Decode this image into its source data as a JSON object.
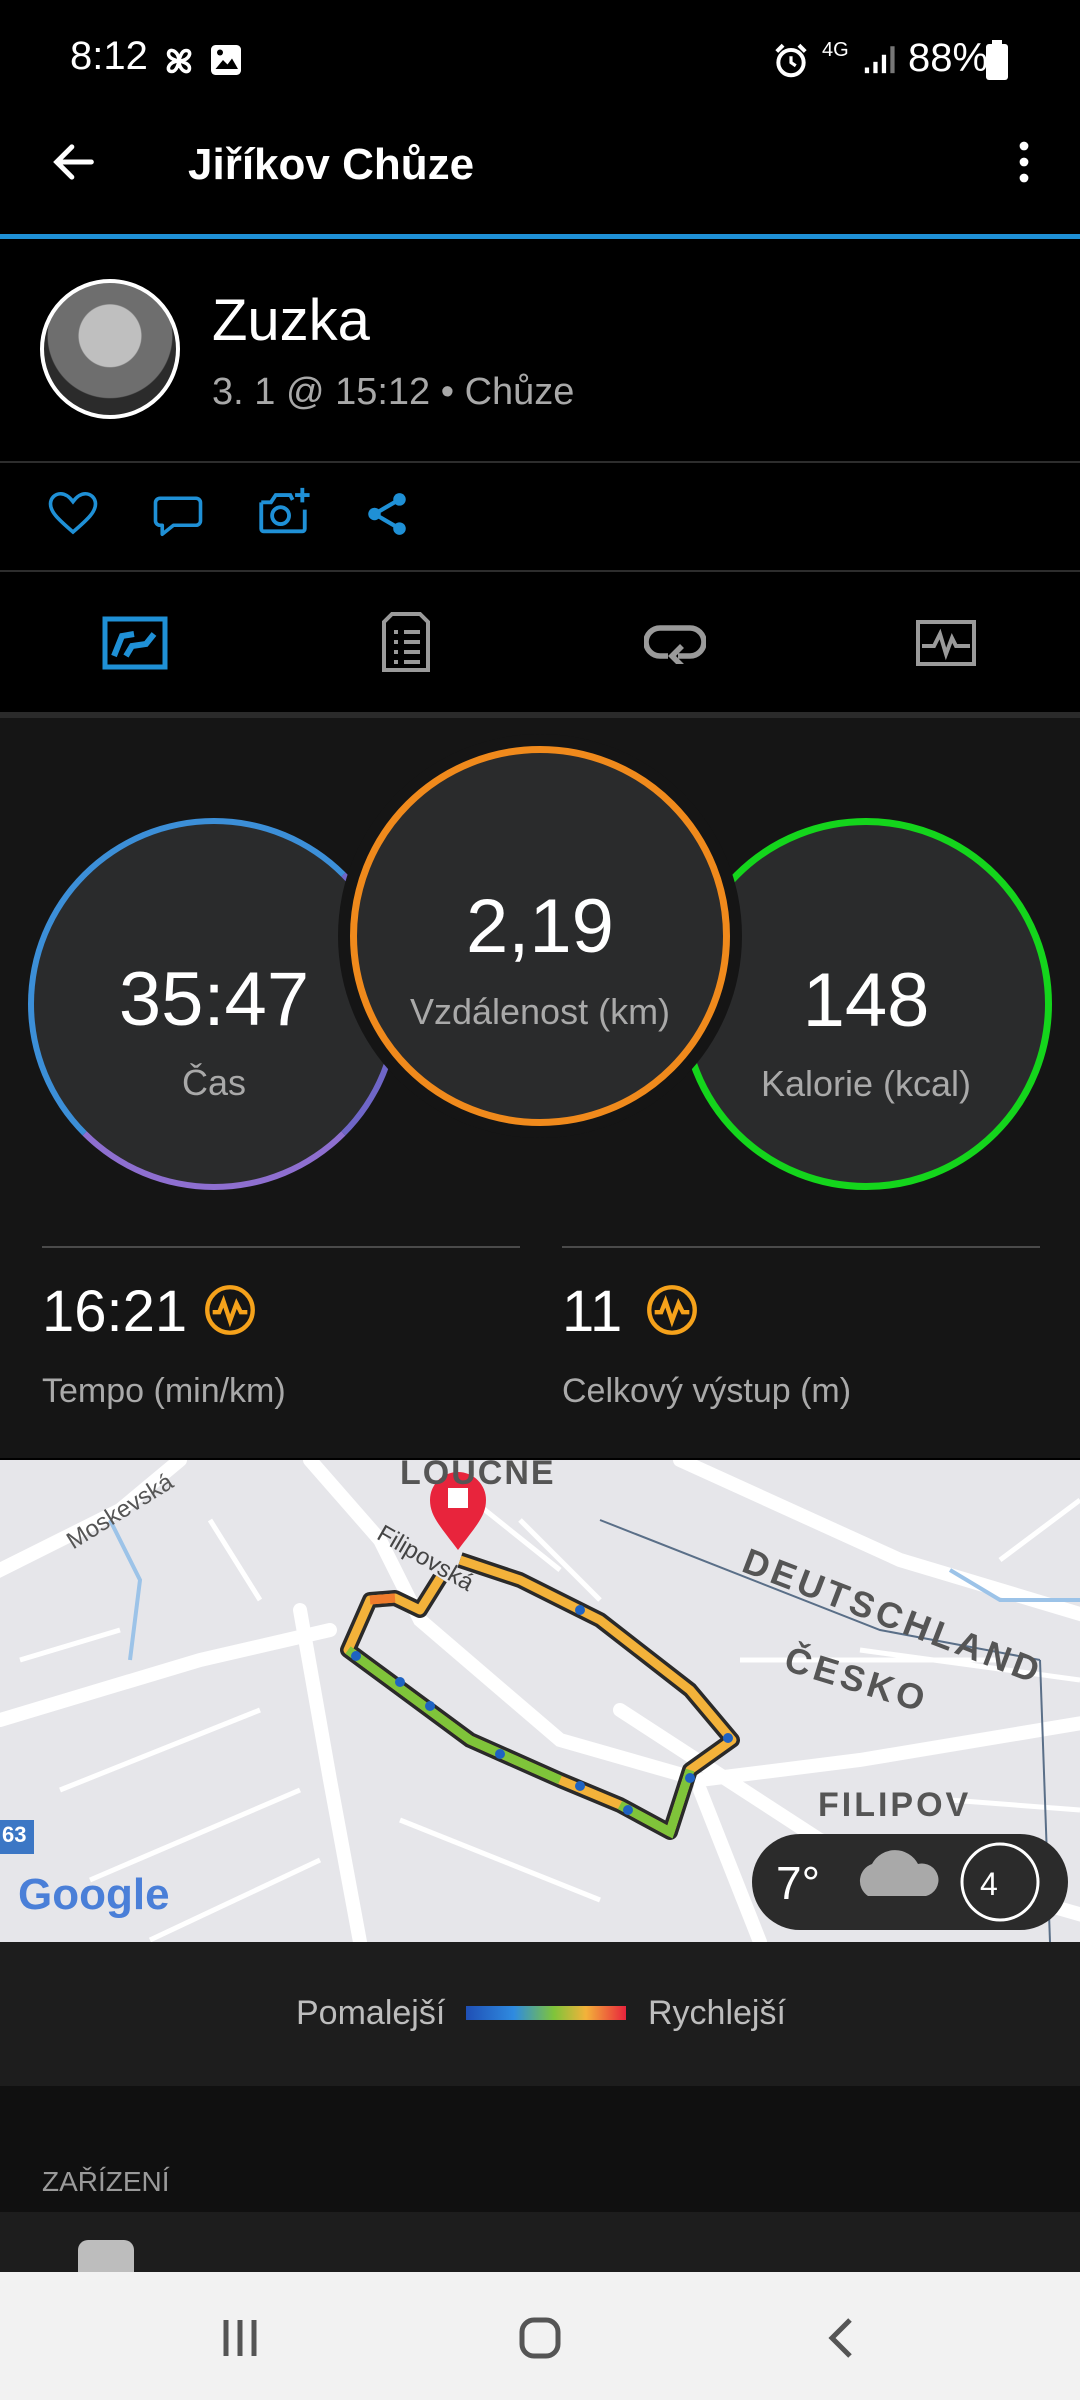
{
  "status_bar": {
    "time": "8:12",
    "battery": "88%",
    "network": "4G"
  },
  "app_bar": {
    "title": "Jiříkov Chůze"
  },
  "profile": {
    "name": "Zuzka",
    "subtitle": "3. 1 @ 15:12 • Chůze"
  },
  "actions": [
    "heart-icon",
    "comment-icon",
    "add-photo-icon",
    "share-icon"
  ],
  "tabs": [
    {
      "icon": "overview-icon",
      "selected": true
    },
    {
      "icon": "details-icon",
      "selected": false
    },
    {
      "icon": "laps-icon",
      "selected": false
    },
    {
      "icon": "chart-icon",
      "selected": false
    }
  ],
  "stats": {
    "time": {
      "value": "35:47",
      "label": "Čas"
    },
    "distance": {
      "value": "2,19",
      "label": "Vzdálenost (km)"
    },
    "calories": {
      "value": "148",
      "label": "Kalorie (kcal)"
    },
    "pace": {
      "value": "16:21",
      "label": "Tempo (min/km)"
    },
    "ascent": {
      "value": "11",
      "label": "Celkový výstup (m)"
    }
  },
  "map": {
    "labels": {
      "loucne": "LOUČNÉ",
      "moskevska": "Moskevská",
      "filipovska": "Filipovská",
      "deutschland": "DEUTSCHLAND",
      "cesko": "ČESKO",
      "filipov": "FILIPOV",
      "road": "63"
    },
    "google": "Google",
    "weather": {
      "temp": "7°",
      "wind": "4"
    }
  },
  "legend": {
    "slow": "Pomalejší",
    "fast": "Rychlejší"
  },
  "device_section": {
    "title": "ZAŘÍZENÍ"
  },
  "colors": {
    "accent": "#1f90d6",
    "time_ring": "#3c8fd8",
    "distance_ring": "#f08a1c",
    "calories_ring": "#14d51c",
    "metric_icon": "#f5a21b"
  }
}
